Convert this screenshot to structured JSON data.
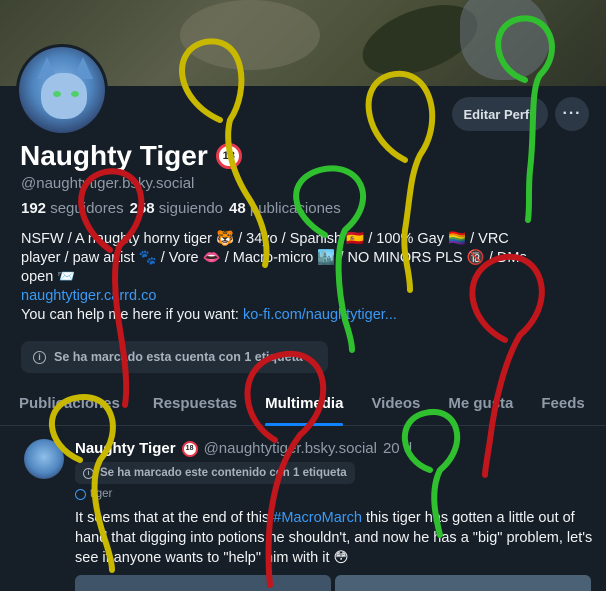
{
  "profile": {
    "display_name": "Naughty Tiger",
    "adult_badge": "18",
    "handle": "@naughtytiger.bsky.social",
    "stats": {
      "followers_count": "192",
      "followers_label": "seguidores",
      "following_count": "258",
      "following_label": "siguiendo",
      "posts_count": "48",
      "posts_label": "publicaciones"
    },
    "bio_line1": "NSFW / A naughty horny tiger 🐯 / 34yo / Spanish 🇪🇸 / 100% Gay 🏳️‍🌈 / VRC",
    "bio_line2": "player / paw artist 🐾 / Vore 👄 / Macro-micro 🏙️ / NO MINORS PLS 🔞 / DMs",
    "bio_line3": "open 📨",
    "bio_link": "naughtytiger.carrd.co",
    "bio_help_prefix": "You can help me here if you want: ",
    "bio_help_link": "ko-fi.com/naughtytiger...",
    "label_notice": "Se ha marcado esta cuenta con 1 etiqueta"
  },
  "buttons": {
    "edit_profile": "Editar Perfil",
    "more": "···"
  },
  "tabs": [
    {
      "label": "Publicaciones",
      "active": false
    },
    {
      "label": "Respuestas",
      "active": false
    },
    {
      "label": "Multimedia",
      "active": true
    },
    {
      "label": "Videos",
      "active": false
    },
    {
      "label": "Me gusta",
      "active": false
    },
    {
      "label": "Feeds",
      "active": false
    }
  ],
  "post": {
    "author": "Naughty Tiger",
    "handle": "@naughtytiger.bsky.social",
    "time": "20 d",
    "label_notice": "Se ha marcado este contenido con 1 etiqueta",
    "tag": "tiger",
    "text_before": "It seems that at the end of this ",
    "hashtag": "#MacroMarch",
    "text_after": " this tiger has gotten a little out of hand that digging into potions he shouldn't, and now he has a \"big\" problem, let's see if anyone wants to \"help\" him with it 😳"
  },
  "colors": {
    "background": "#161e27",
    "accent": "#1083fe",
    "link": "#3b9af5",
    "scribble_red": "#c0161c",
    "scribble_yellow": "#c8b800",
    "scribble_green": "#2fbf2f"
  }
}
